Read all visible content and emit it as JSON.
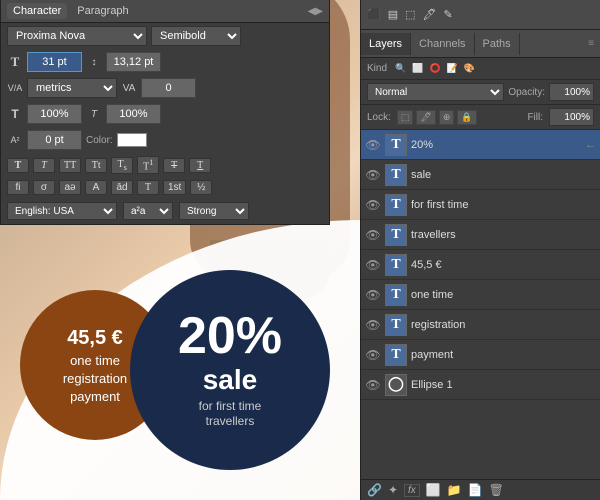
{
  "charPanel": {
    "title": "Character",
    "tab1": "Character",
    "tab2": "Paragraph",
    "font": "Proxima Nova",
    "style": "Semibold",
    "size": "31 pt",
    "leading": "13,12 pt",
    "metrics": "metrics",
    "kerning": "0",
    "scaleV": "100%",
    "scaleH": "100%",
    "baseline": "0 pt",
    "color_label": "Color:",
    "lang": "English: USA",
    "aa": "a²a",
    "sharpness": "Strong",
    "format_btns": [
      "T",
      "T",
      "TT",
      "Tt",
      "T",
      "T₁",
      "T",
      "T²"
    ],
    "special_btns": [
      "fi",
      "σ",
      "aə",
      "A",
      "ād",
      "T",
      "1st",
      "½"
    ]
  },
  "layers": {
    "title": "Layers",
    "tab1": "Layers",
    "tab2": "Channels",
    "tab3": "Paths",
    "search_placeholder": "Kind",
    "blend_mode": "Normal",
    "opacity_label": "Opacity:",
    "opacity_value": "100%",
    "lock_label": "Lock:",
    "fill_label": "Fill:",
    "fill_value": "100%",
    "items": [
      {
        "name": "20%",
        "type": "text",
        "selected": true,
        "eye": true
      },
      {
        "name": "sale",
        "type": "text",
        "selected": false,
        "eye": true
      },
      {
        "name": "for first time",
        "type": "text",
        "selected": false,
        "eye": true
      },
      {
        "name": "travellers",
        "type": "text",
        "selected": false,
        "eye": true
      },
      {
        "name": "45,5 €",
        "type": "text",
        "selected": false,
        "eye": true
      },
      {
        "name": "one time",
        "type": "text",
        "selected": false,
        "eye": true
      },
      {
        "name": "registration",
        "type": "text",
        "selected": false,
        "eye": true
      },
      {
        "name": "payment",
        "type": "text",
        "selected": false,
        "eye": true
      },
      {
        "name": "Ellipse 1",
        "type": "shape",
        "selected": false,
        "eye": true
      }
    ]
  },
  "canvas": {
    "price": "45,5 €",
    "line2": "one time",
    "line3": "registration",
    "line4": "payment",
    "big_pct": "20%",
    "big_sale": "sale",
    "big_sub1": "for first time",
    "big_sub2": "travellers"
  }
}
